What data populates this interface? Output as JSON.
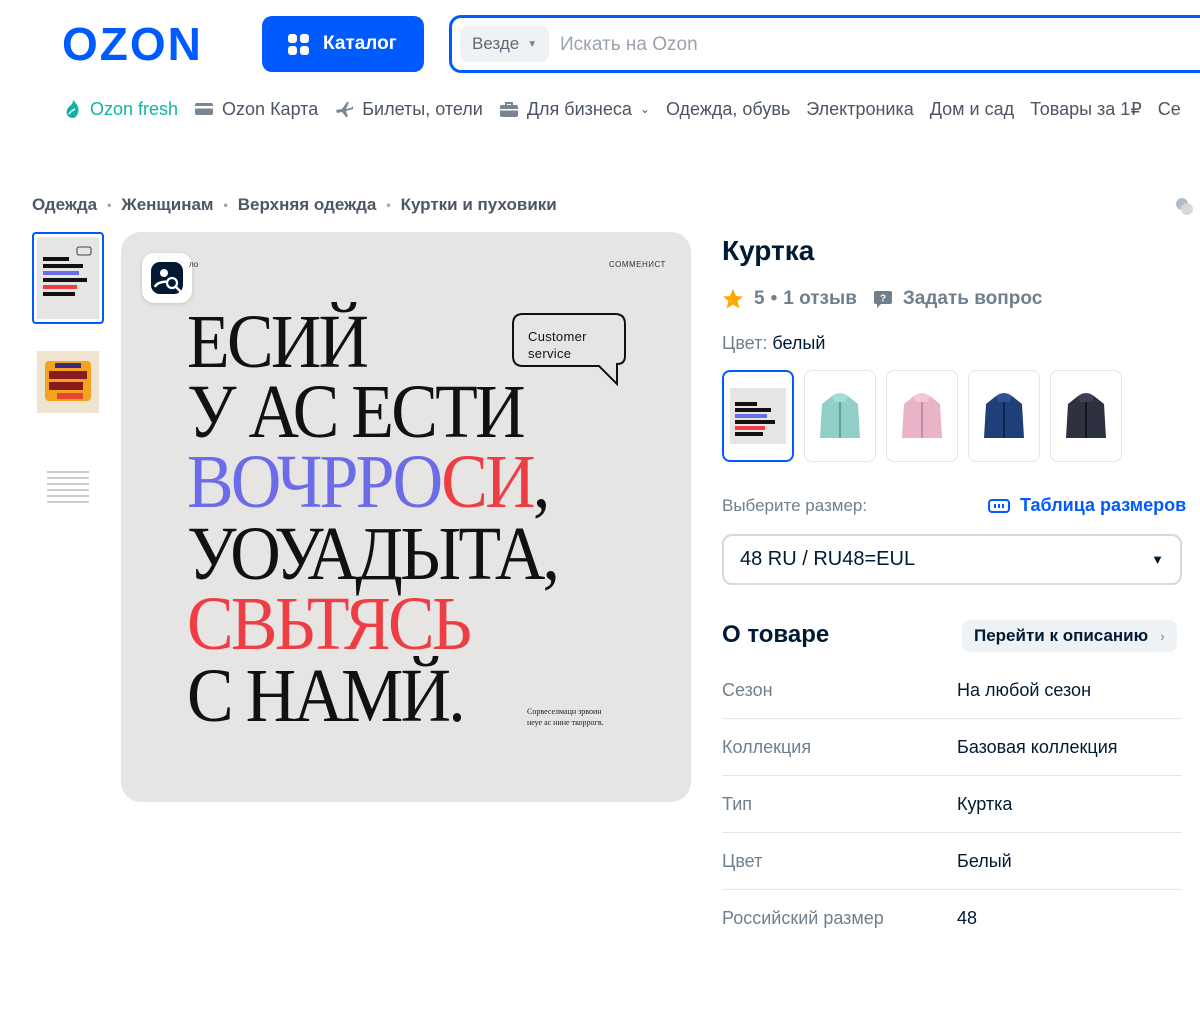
{
  "header": {
    "logo_text": "OZON",
    "catalog_label": "Каталог",
    "search_scope": "Везде",
    "search_placeholder": "Искать на Ozon"
  },
  "nav": [
    {
      "label": "Ozon fresh",
      "icon": "leaf-icon"
    },
    {
      "label": "Ozon Карта",
      "icon": "card-icon"
    },
    {
      "label": "Билеты, отели",
      "icon": "plane-icon"
    },
    {
      "label": "Для бизнеса",
      "icon": "briefcase-icon"
    },
    {
      "label": "Одежда, обувь"
    },
    {
      "label": "Электроника"
    },
    {
      "label": "Дом и сад"
    },
    {
      "label": "Товары за 1₽"
    },
    {
      "label": "Се"
    }
  ],
  "breadcrumbs": [
    "Одежда",
    "Женщинам",
    "Верхняя одежда",
    "Куртки и пуховики"
  ],
  "poster": {
    "top_left": "ло",
    "top_right": "СОММЕНИСТ",
    "bubble": [
      "Customer",
      "service"
    ],
    "lines": [
      "ЕСИЙ",
      "У АС ЕСТИ",
      "ВОЧРРО",
      "СИ",
      ",",
      "УОУАДЫТА,",
      "СВЬТЯСЬ",
      "С НАМЙ."
    ],
    "caption": [
      "Сорвеселмацн зрвоин",
      "неуе ас нине ткоррогв."
    ],
    "accent_blue": "#6c6ce8",
    "accent_red": "#ee3e43"
  },
  "product": {
    "title": "Куртка",
    "rating": "5",
    "reviews": "1 отзыв",
    "ask_label": "Задать вопрос",
    "color_label": "Цвет:",
    "color_value": "белый",
    "size_label": "Выберите размер:",
    "size_table_label": "Таблица размеров",
    "size_selected": "48 RU / RU48=EUL"
  },
  "about": {
    "title": "О товаре",
    "goto_label": "Перейти к описанию",
    "specs": [
      {
        "key": "Сезон",
        "value": "На любой сезон"
      },
      {
        "key": "Коллекция",
        "value": "Базовая коллекция"
      },
      {
        "key": "Тип",
        "value": "Куртка"
      },
      {
        "key": "Цвет",
        "value": "Белый"
      },
      {
        "key": "Российский размер",
        "value": "48"
      }
    ]
  },
  "colors": {
    "brand": "#005bff",
    "fresh": "#10b3a4",
    "star": "#ffa800"
  }
}
